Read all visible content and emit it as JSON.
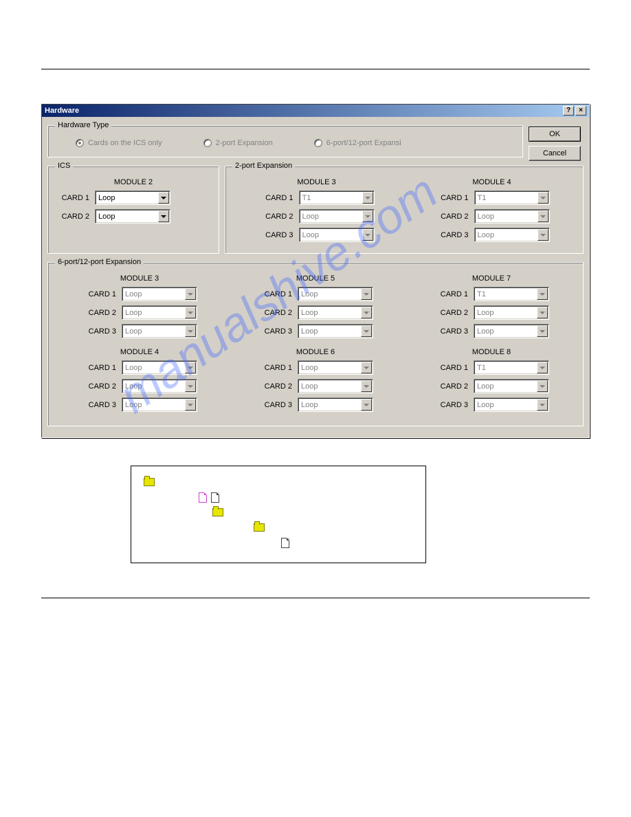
{
  "dialog": {
    "title": "Hardware",
    "buttons": {
      "ok": "OK",
      "cancel": "Cancel"
    },
    "hw_type": {
      "legend": "Hardware Type",
      "options": [
        {
          "label": "Cards on the ICS only",
          "selected": true
        },
        {
          "label": "2-port Expansion",
          "selected": false
        },
        {
          "label": "6-port/12-port Expansi",
          "selected": false
        }
      ]
    },
    "ics": {
      "legend": "ICS",
      "module_header": "MODULE 2",
      "cards": [
        {
          "label": "CARD 1",
          "value": "Loop",
          "enabled": true
        },
        {
          "label": "CARD 2",
          "value": "Loop",
          "enabled": true
        }
      ]
    },
    "two_port": {
      "legend": "2-port Expansion",
      "modules": [
        {
          "header": "MODULE 3",
          "cards": [
            {
              "label": "CARD 1",
              "value": "T1"
            },
            {
              "label": "CARD 2",
              "value": "Loop"
            },
            {
              "label": "CARD 3",
              "value": "Loop"
            }
          ]
        },
        {
          "header": "MODULE 4",
          "cards": [
            {
              "label": "CARD 1",
              "value": "T1"
            },
            {
              "label": "CARD 2",
              "value": "Loop"
            },
            {
              "label": "CARD 3",
              "value": "Loop"
            }
          ]
        }
      ]
    },
    "six_port": {
      "legend": "6-port/12-port Expansion",
      "columns": [
        [
          {
            "header": "MODULE 3",
            "cards": [
              {
                "label": "CARD 1",
                "value": "Loop"
              },
              {
                "label": "CARD 2",
                "value": "Loop"
              },
              {
                "label": "CARD 3",
                "value": "Loop"
              }
            ]
          },
          {
            "header": "MODULE 4",
            "cards": [
              {
                "label": "CARD 1",
                "value": "Loop"
              },
              {
                "label": "CARD 2",
                "value": "Loop"
              },
              {
                "label": "CARD 3",
                "value": "Loop"
              }
            ]
          }
        ],
        [
          {
            "header": "MODULE 5",
            "cards": [
              {
                "label": "CARD 1",
                "value": "Loop"
              },
              {
                "label": "CARD 2",
                "value": "Loop"
              },
              {
                "label": "CARD 3",
                "value": "Loop"
              }
            ]
          },
          {
            "header": "MODULE 6",
            "cards": [
              {
                "label": "CARD 1",
                "value": "Loop"
              },
              {
                "label": "CARD 2",
                "value": "Loop"
              },
              {
                "label": "CARD 3",
                "value": "Loop"
              }
            ]
          }
        ],
        [
          {
            "header": "MODULE 7",
            "cards": [
              {
                "label": "CARD 1",
                "value": "T1"
              },
              {
                "label": "CARD 2",
                "value": "Loop"
              },
              {
                "label": "CARD 3",
                "value": "Loop"
              }
            ]
          },
          {
            "header": "MODULE 8",
            "cards": [
              {
                "label": "CARD 1",
                "value": "T1"
              },
              {
                "label": "CARD 2",
                "value": "Loop"
              },
              {
                "label": "CARD 3",
                "value": "Loop"
              }
            ]
          }
        ]
      ]
    }
  },
  "watermark": "manualshive.com",
  "titlebar_icons": {
    "help": "?",
    "close": "×"
  }
}
